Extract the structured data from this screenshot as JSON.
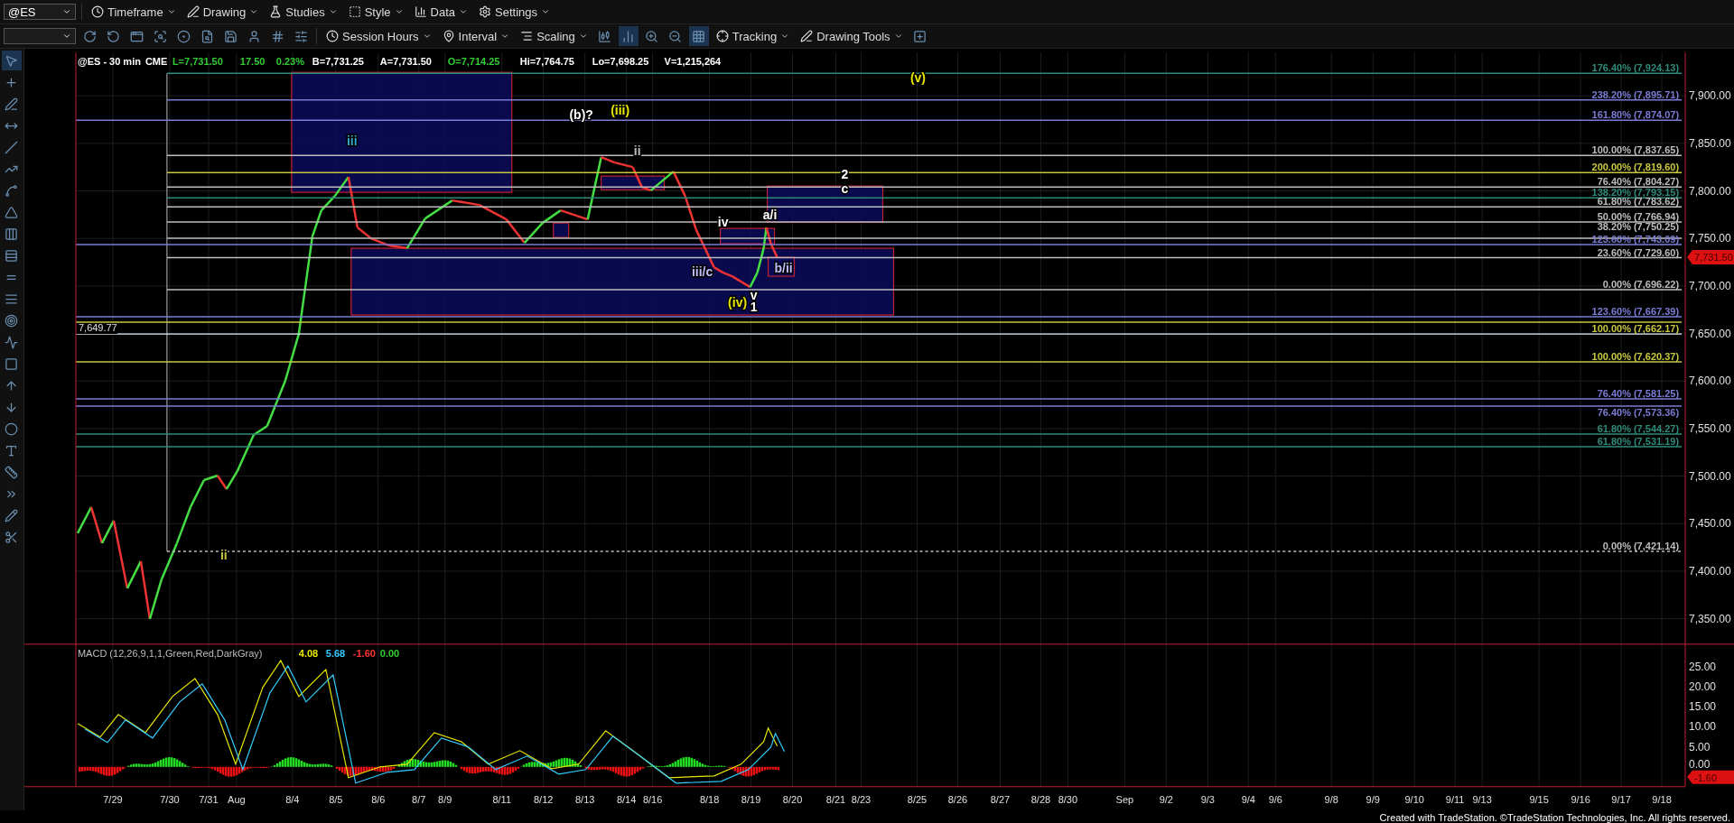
{
  "toolbar_main": {
    "symbol": "@ES",
    "items": [
      {
        "kind": "timeframe",
        "label": "Timeframe"
      },
      {
        "kind": "drawing",
        "label": "Drawing"
      },
      {
        "kind": "studies",
        "label": "Studies"
      },
      {
        "kind": "style",
        "label": "Style"
      },
      {
        "kind": "data",
        "label": "Data"
      },
      {
        "kind": "settings",
        "label": "Settings"
      }
    ]
  },
  "toolbar_secondary": {
    "items": [
      {
        "kind": "session",
        "label": "Session Hours"
      },
      {
        "kind": "interval",
        "label": "Interval"
      },
      {
        "kind": "scaling",
        "label": "Scaling"
      },
      {
        "kind": "tracking",
        "label": "Tracking"
      },
      {
        "kind": "drawingtools",
        "label": "Drawing Tools"
      }
    ]
  },
  "chart_header": {
    "fields": [
      {
        "text": "@ES - 30 min",
        "color": "#ffffff"
      },
      {
        "text": "CME",
        "color": "#ffffff"
      },
      {
        "text": "L=7,731.50",
        "color": "#33cc33"
      },
      {
        "text": "17.50",
        "color": "#33cc33"
      },
      {
        "text": "0.23%",
        "color": "#33cc33"
      },
      {
        "text": "B=7,731.25",
        "color": "#ffffff"
      },
      {
        "text": "A=7,731.50",
        "color": "#ffffff"
      },
      {
        "text": "O=7,714.25",
        "color": "#33cc33"
      },
      {
        "text": "Hi=7,764.75",
        "color": "#ffffff"
      },
      {
        "text": "Lo=7,698.25",
        "color": "#ffffff"
      },
      {
        "text": "V=1,215,264",
        "color": "#ffffff"
      }
    ]
  },
  "price_axis": [
    "7,900.00",
    "7,850.00",
    "7,800.00",
    "7,750.00",
    "7,700.00",
    "7,650.00",
    "7,600.00",
    "7,550.00",
    "7,500.00",
    "7,450.00",
    "7,400.00",
    "7,350.00"
  ],
  "last_price": "7,731.50",
  "left_price_label": "7,649.77",
  "fib_levels": [
    {
      "label": "176.40% (7,924.13)",
      "color": "#2e8b7a",
      "dashed": false
    },
    {
      "label": "238.20% (7,895.71)",
      "color": "#7b7bd6",
      "dashed": false
    },
    {
      "label": "161.80% (7,874.07)",
      "color": "#7b7bd6",
      "dashed": false
    },
    {
      "label": "100.00% (7,837.65)",
      "color": "#bdbdbd",
      "dashed": false
    },
    {
      "label": "200.00% (7,819.60)",
      "color": "#c8c840",
      "dashed": false
    },
    {
      "label": "76.40% (7,804.27)",
      "color": "#bdbdbd",
      "dashed": false
    },
    {
      "label": "138.20% (7,793.15)",
      "color": "#2e8b7a",
      "dashed": false
    },
    {
      "label": "61.80% (7,783.62)",
      "color": "#bdbdbd",
      "dashed": false
    },
    {
      "label": "50.00% (7,766.94)",
      "color": "#bdbdbd",
      "dashed": false
    },
    {
      "label": "38.20% (7,750.25)",
      "color": "#bdbdbd",
      "dashed": false
    },
    {
      "label": "123.60% (7,743.09)",
      "color": "#7b7bd6",
      "dashed": false
    },
    {
      "label": "23.60% (7,729.60)",
      "color": "#bdbdbd",
      "dashed": false
    },
    {
      "label": "0.00% (7,696.22)",
      "color": "#bdbdbd",
      "dashed": false
    },
    {
      "label": "123.60% (7,667.39)",
      "color": "#7b7bd6",
      "dashed": false
    },
    {
      "label": "100.00% (7,662.17)",
      "color": "#c8c840",
      "dashed": false
    },
    {
      "label": "100.00% (7,620.37)",
      "color": "#c8c840",
      "dashed": false
    },
    {
      "label": "76.40% (7,581.25)",
      "color": "#7b7bd6",
      "dashed": false
    },
    {
      "label": "76.40% (7,573.36)",
      "color": "#7b7bd6",
      "dashed": false
    },
    {
      "label": "61.80% (7,544.27)",
      "color": "#2e8b7a",
      "dashed": false
    },
    {
      "label": "61.80% (7,531.19)",
      "color": "#2e8b7a",
      "dashed": false
    },
    {
      "label": "0.00% (7,421.14)",
      "color": "#bdbdbd",
      "dashed": true
    }
  ],
  "wave_labels": [
    {
      "text": "(v)",
      "color": "#e6e600"
    },
    {
      "text": "(b)?",
      "color": "#ffffff"
    },
    {
      "text": "(iii)",
      "color": "#e6e600"
    },
    {
      "text": "iii",
      "color": "#33aacc"
    },
    {
      "text": "ii",
      "color": "#bdbdbd"
    },
    {
      "text": "2",
      "color": "#ffffff"
    },
    {
      "text": "c",
      "color": "#ffffff"
    },
    {
      "text": "a/i",
      "color": "#ffffff"
    },
    {
      "text": "iv",
      "color": "#ffffff"
    },
    {
      "text": "iii/c",
      "color": "#bdbdff"
    },
    {
      "text": "b/ii",
      "color": "#bdbdff"
    },
    {
      "text": "(iv)",
      "color": "#e6e600"
    },
    {
      "text": "v",
      "color": "#ffffff"
    },
    {
      "text": "1",
      "color": "#ffffff"
    },
    {
      "text": "ii",
      "color": "#c8c840"
    }
  ],
  "macd": {
    "title": "MACD (12,26,9,1,1,Green,Red,DarkGray)",
    "values": [
      {
        "text": "4.08",
        "color": "#e6e600"
      },
      {
        "text": "5.68",
        "color": "#33ccff"
      },
      {
        "text": "-1.60",
        "color": "#ff3333"
      },
      {
        "text": "0.00",
        "color": "#33cc33"
      }
    ],
    "axis": [
      "25.00",
      "20.00",
      "15.00",
      "10.00",
      "5.00",
      "0.00"
    ],
    "last_value": "-1.60"
  },
  "date_axis": [
    "7/29",
    "7/30",
    "7/31",
    "Aug",
    "8/4",
    "8/5",
    "8/6",
    "8/7",
    "8/9",
    "8/11",
    "8/12",
    "8/13",
    "8/14",
    "8/16",
    "8/18",
    "8/19",
    "8/20",
    "8/21",
    "8/23",
    "8/25",
    "8/26",
    "8/27",
    "8/28",
    "8/30",
    "Sep",
    "9/2",
    "9/3",
    "9/4",
    "9/6",
    "9/8",
    "9/9",
    "9/10",
    "9/11",
    "9/13",
    "9/15",
    "9/16",
    "9/17",
    "9/18"
  ],
  "footer": "Created with TradeStation. ©TradeStation Technologies, Inc. All rights reserved."
}
